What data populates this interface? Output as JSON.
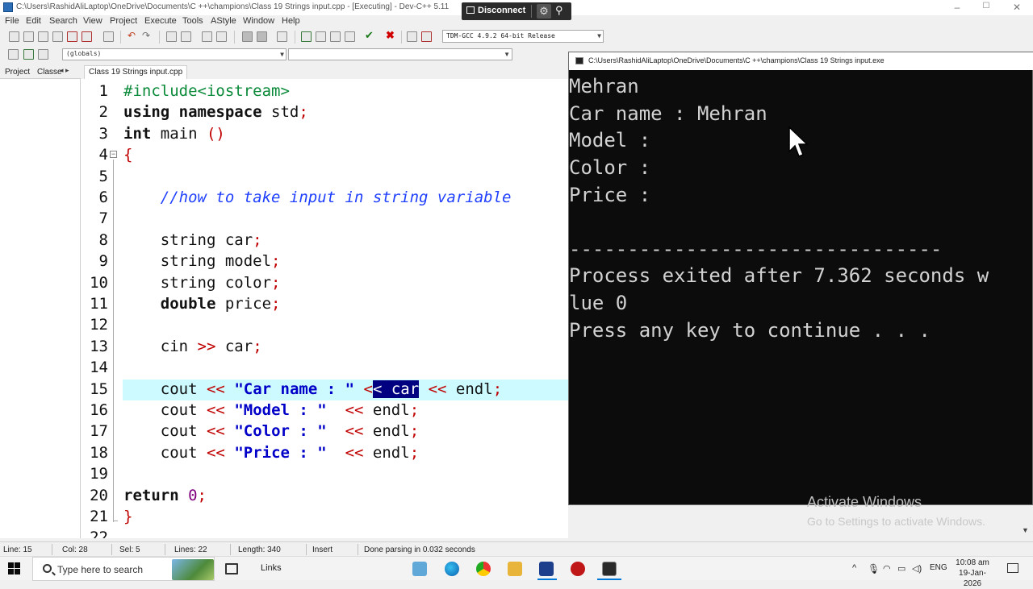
{
  "window": {
    "title": "C:\\Users\\RashidAliLaptop\\OneDrive\\Documents\\C ++\\champions\\Class 19 Strings input.cpp - [Executing] - Dev-C++ 5.11",
    "minimize": "–",
    "maximize": "☐",
    "close": "✕"
  },
  "remote": {
    "disconnect_label": "Disconnect",
    "gear": "⚙",
    "pin": "⚲"
  },
  "menu": [
    "File",
    "Edit",
    "Search",
    "View",
    "Project",
    "Execute",
    "Tools",
    "AStyle",
    "Window",
    "Help"
  ],
  "toolbar": {
    "compiler": "TDM-GCC 4.9.2 64-bit Release",
    "globals": "(globals)",
    "icons": [
      "new-file-icon",
      "open-icon",
      "save-icon",
      "save-all-icon",
      "close-icon",
      "close-all-icon",
      "print-icon",
      "undo-icon",
      "redo-icon",
      "find-icon",
      "replace-icon",
      "indent-icon",
      "unindent-icon",
      "goto-icon",
      "bookmark-icon",
      "compile-icon",
      "run-icon",
      "compile-run-icon",
      "rebuild-icon",
      "syntax-check-icon",
      "stop-icon",
      "chart-icon",
      "debug-icon"
    ]
  },
  "left_tabs": {
    "project": "Project",
    "classes": "Classe",
    "arrows": "◂ ▸"
  },
  "editor": {
    "tab_label": "Class 19 Strings input.cpp",
    "lines": [
      {
        "n": "1"
      },
      {
        "n": "2"
      },
      {
        "n": "3"
      },
      {
        "n": "4"
      },
      {
        "n": "5"
      },
      {
        "n": "6"
      },
      {
        "n": "7"
      },
      {
        "n": "8"
      },
      {
        "n": "9"
      },
      {
        "n": "10"
      },
      {
        "n": "11"
      },
      {
        "n": "12"
      },
      {
        "n": "13"
      },
      {
        "n": "14"
      },
      {
        "n": "15"
      },
      {
        "n": "16"
      },
      {
        "n": "17"
      },
      {
        "n": "18"
      },
      {
        "n": "19"
      },
      {
        "n": "20"
      },
      {
        "n": "21"
      },
      {
        "n": "22"
      }
    ],
    "code": {
      "l1_pp": "#include<iostream>",
      "l2_kw1": "using",
      "l2_kw2": "namespace",
      "l2_rest": " std",
      "l3_kw": "int",
      "l3_rest": " main ",
      "l3_paren": "()",
      "l4_brace": "{",
      "l6_cm": "//how to take input in string variable",
      "l8_a": "string car",
      "l9_a": "string model",
      "l10_a": "string color",
      "l11_kw": "double",
      "l11_a": " price",
      "l13_a": "cin ",
      "l13_op": ">>",
      "l13_b": " car",
      "cout": "cout ",
      "shl": "<<",
      "l15_str": "\"Car name : \"",
      "l15_sel1": "<",
      "l15_sel2": "< car",
      "l15_end": " endl",
      "l16_str": "\"Model : \"",
      "l17_str": "\"Color : \"",
      "l18_str": "\"Price : \"",
      "endl": " endl",
      "l20_kw": "return",
      "l20_num": "0",
      "l21_brace": "}",
      "semi": ";"
    },
    "fold_marker": "−"
  },
  "console": {
    "title": "C:\\Users\\RashidAliLaptop\\OneDrive\\Documents\\C ++\\champions\\Class 19 Strings input.exe",
    "lines": [
      "Mehran",
      "Car name : Mehran",
      "Model :",
      "Color :",
      "Price :",
      "",
      "--------------------------------",
      "Process exited after 7.362 seconds w",
      "lue 0",
      "Press any key to continue . . ."
    ]
  },
  "watermark": {
    "line1": "Activate Windows",
    "line2": "Go to Settings to activate Windows."
  },
  "status": {
    "line": "Line:   15",
    "col": "Col:    28",
    "sel": "Sel:    5",
    "lines": "Lines:   22",
    "length": "Length:  340",
    "mode": "Insert",
    "message": "Done parsing in 0.032 seconds"
  },
  "taskbar": {
    "search_placeholder": "Type here to search",
    "links": "Links",
    "tray_arrow": "^",
    "lang": "ENG",
    "time": "10:08 am",
    "date": "19-Jan-2026"
  },
  "colors": {
    "selection": "#000080",
    "current_line": "#ccfaff",
    "operator": "#c00000",
    "comment": "#1f3fff",
    "string": "#0000c8",
    "console_bg": "#0c0c0c"
  }
}
